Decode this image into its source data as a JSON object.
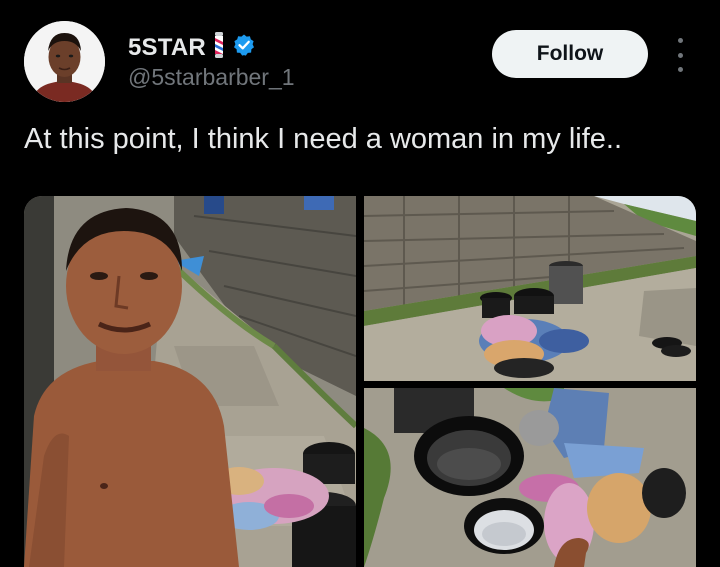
{
  "user": {
    "display_name": "5STAR",
    "handle": "@5starbarber_1",
    "verified": true,
    "emoji_icon": "barber-pole-icon"
  },
  "actions": {
    "follow_label": "Follow",
    "more_icon": "more-options-icon"
  },
  "tweet": {
    "text": "At this point, I think I need a woman in my life.."
  },
  "colors": {
    "background": "#000000",
    "text": "#e7e9ea",
    "muted": "#71767b",
    "verified_blue": "#1d9bf0",
    "follow_button_bg": "#eff3f4"
  },
  "media": {
    "photo_count": 3
  }
}
